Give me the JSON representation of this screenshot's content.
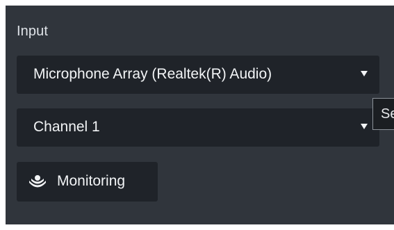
{
  "input": {
    "section_title": "Input",
    "device_select": {
      "selected": "Microphone Array (Realtek(R) Audio)",
      "caret_icon": "caret-down-icon"
    },
    "channel_select": {
      "selected": "Channel 1",
      "caret_icon": "caret-down-icon"
    },
    "tooltip": {
      "text": "Se"
    },
    "monitoring_button": {
      "label": "Monitoring",
      "icon": "monitoring-icon"
    }
  },
  "colors": {
    "panel_bg": "#30353c",
    "control_bg": "#1f2329",
    "text": "#f2f4f6"
  }
}
